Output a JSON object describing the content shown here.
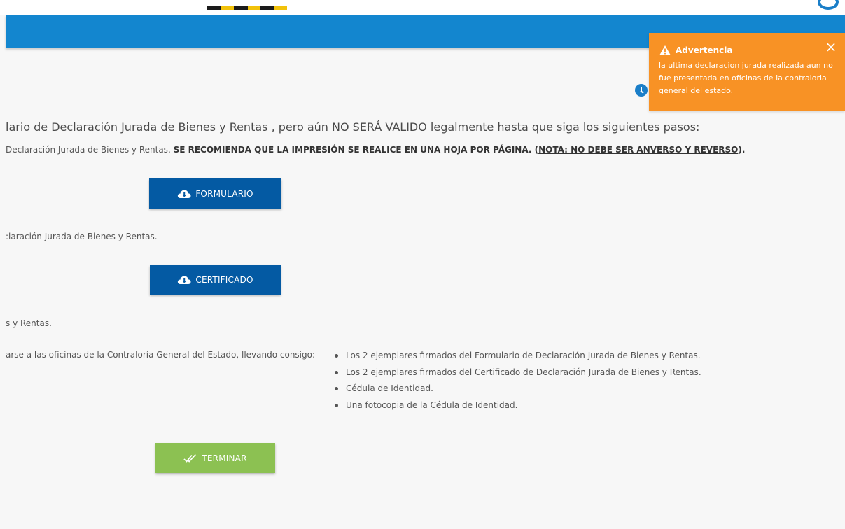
{
  "header": {
    "logo_icon": "logo-stripe",
    "user_icon": "user-circle-icon",
    "bar_color": "#1386cf"
  },
  "toast": {
    "title": "Advertencia",
    "message": "la ultima declaracion jurada realizada aun no fue presentada en oficinas de la contraloria general del estado.",
    "icon": "warning-triangle-icon",
    "close_label": "×",
    "color": "#f89225"
  },
  "clock_icon": "clock-icon",
  "content": {
    "main_line": "lario de Declaración Jurada de Bienes y Rentas , pero aún NO SERÁ VALIDO legalmente hasta que siga los siguientes pasos:",
    "print_line_start": "Declaración Jurada de Bienes y Rentas. ",
    "print_line_bold": "SE RECOMIENDA QUE LA IMPRESIÓN SE REALICE EN UNA HOJA POR PÁGINA. (",
    "print_line_note": "NOTA: NO DEBE SER ANVERSO Y REVERSO",
    "print_line_end": ").",
    "cert_line": ":laración Jurada de Bienes y Rentas.",
    "sign_line": "s y Rentas.",
    "go_line": "arse a las oficinas de la Contraloría General del Estado, llevando consigo:",
    "requirements": [
      "Los 2 ejemplares firmados del Formulario de Declaración Jurada de Bienes y Rentas.",
      "Los 2 ejemplares firmados del Certificado de Declaración Jurada de Bienes y Rentas.",
      "Cédula de Identidad.",
      "Una fotocopia de la Cédula de Identidad."
    ]
  },
  "buttons": {
    "formulario": "FORMULARIO",
    "certificado": "CERTIFICADO",
    "terminar": "TERMINAR",
    "download_icon": "cloud-download-icon",
    "check_icon": "double-check-icon",
    "blue": "#045aa3",
    "green": "#8cc152"
  }
}
